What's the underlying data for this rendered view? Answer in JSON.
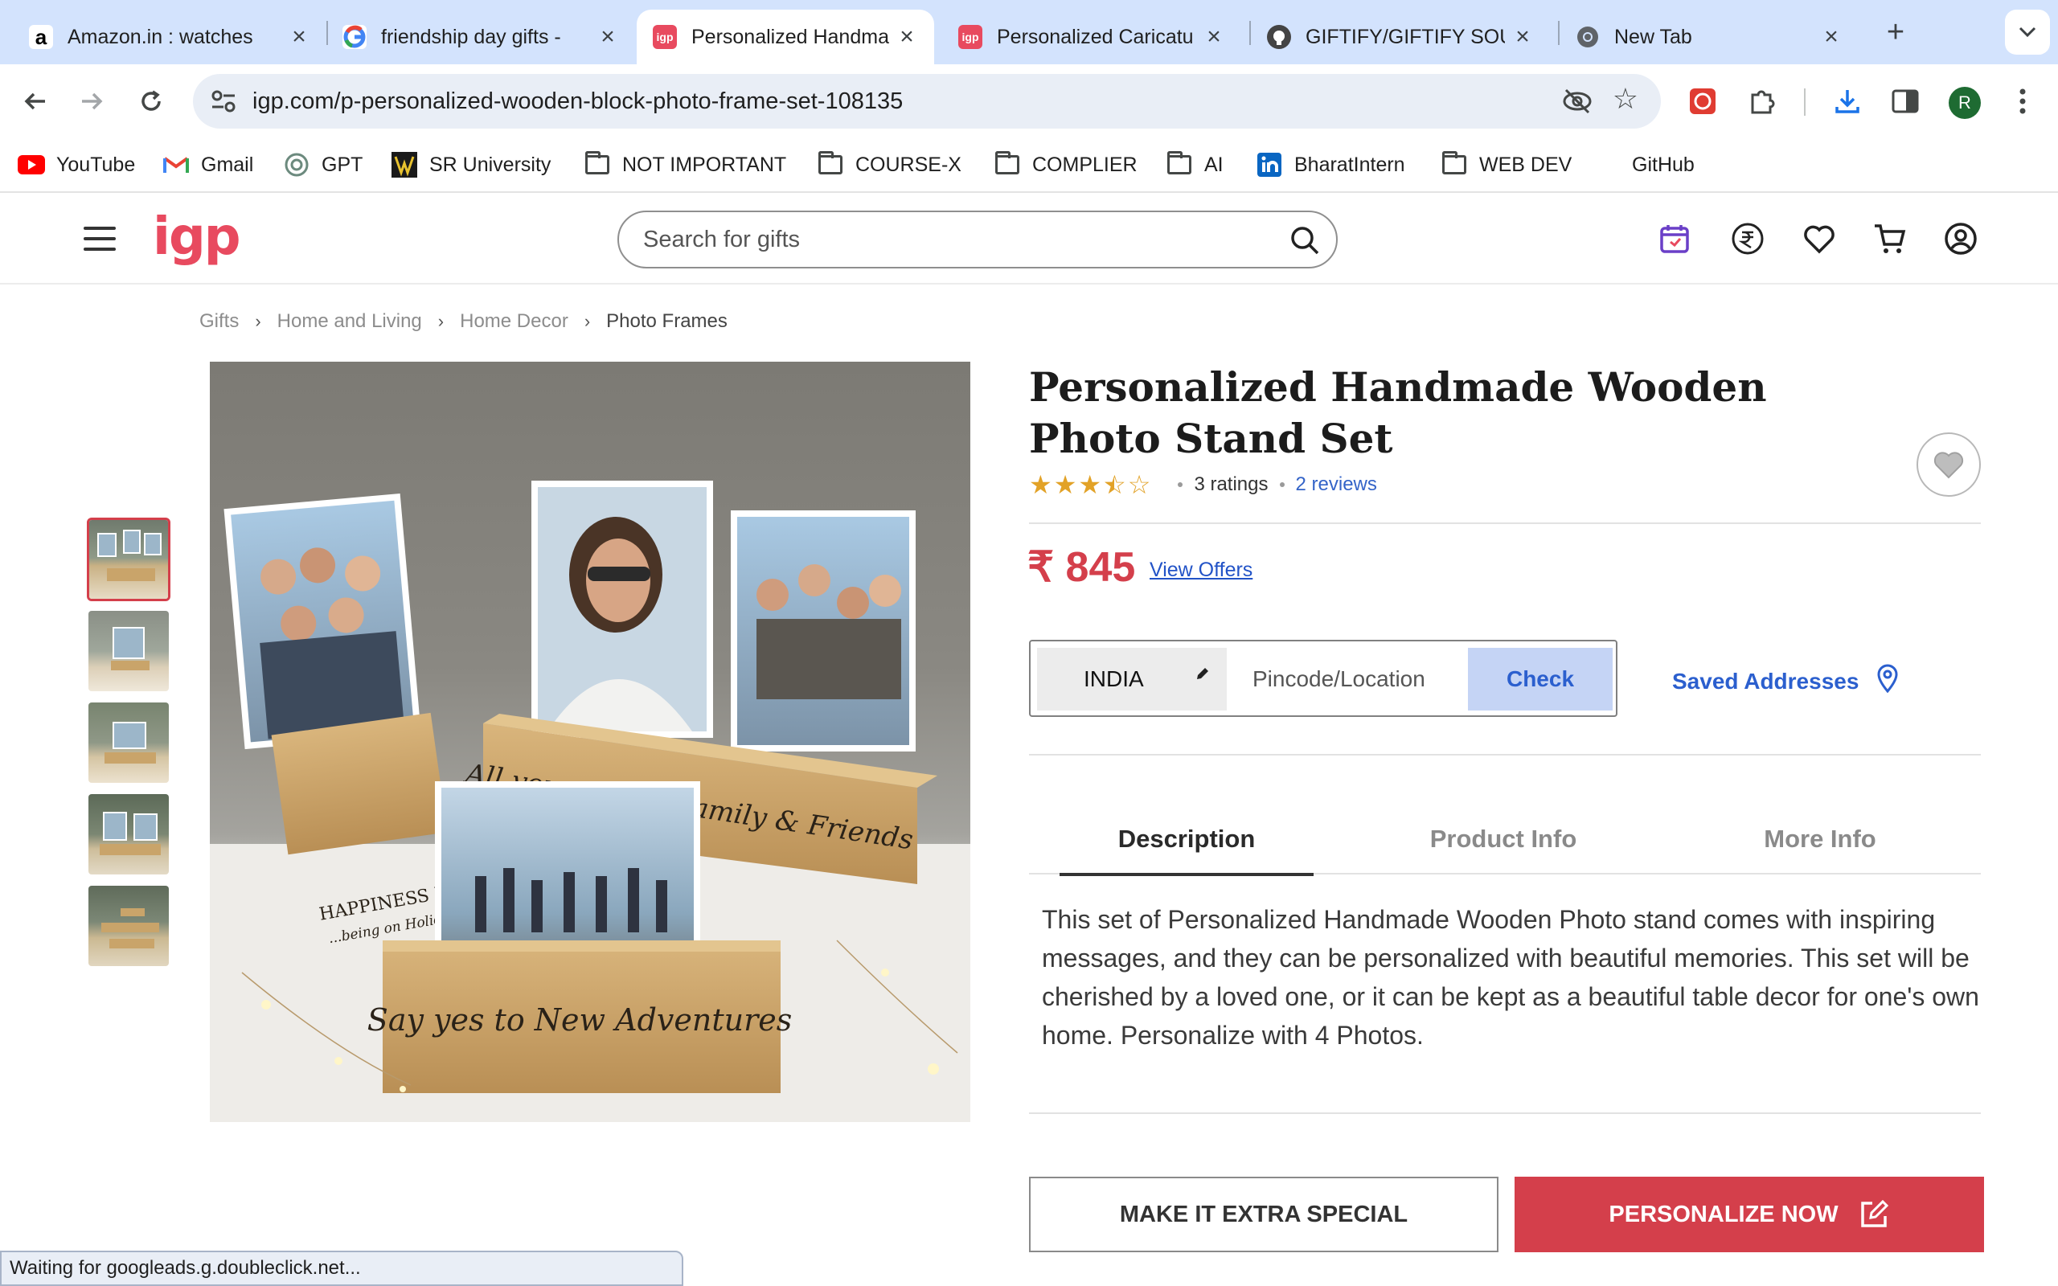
{
  "browser": {
    "tabs": [
      {
        "title": "Amazon.in : watches",
        "favicon": "amazon-icon"
      },
      {
        "title": "friendship day gifts -",
        "favicon": "google-icon"
      },
      {
        "title": "Personalized Handma",
        "favicon": "igp-icon",
        "active": true
      },
      {
        "title": "Personalized Caricatu",
        "favicon": "igp-icon"
      },
      {
        "title": "GIFTIFY/GIFTIFY SOU",
        "favicon": "github-icon"
      },
      {
        "title": "New Tab",
        "favicon": "chrome-icon"
      }
    ],
    "url": "igp.com/p-personalized-wooden-block-photo-frame-set-108135",
    "profile_initial": "R",
    "bookmarks": [
      {
        "label": "YouTube",
        "icon": "youtube-icon"
      },
      {
        "label": "Gmail",
        "icon": "gmail-icon"
      },
      {
        "label": "GPT",
        "icon": "openai-icon"
      },
      {
        "label": "SR University",
        "icon": "sr-university-icon"
      },
      {
        "label": "NOT IMPORTANT",
        "icon": "folder-icon"
      },
      {
        "label": "COURSE-X",
        "icon": "folder-icon"
      },
      {
        "label": "COMPLIER",
        "icon": "folder-icon"
      },
      {
        "label": "AI",
        "icon": "folder-icon"
      },
      {
        "label": "BharatIntern",
        "icon": "linkedin-icon"
      },
      {
        "label": "WEB DEV",
        "icon": "folder-icon"
      },
      {
        "label": "GitHub",
        "icon": "none"
      }
    ],
    "status_text": "Waiting for googleads.g.doubleclick.net..."
  },
  "site": {
    "logo": "igp",
    "search_placeholder": "Search for gifts",
    "header_icons": [
      "calendar-icon",
      "rupee-currency-icon",
      "wishlist-heart-icon",
      "cart-icon",
      "account-icon"
    ],
    "brand_color": "#e84a5f"
  },
  "breadcrumb": [
    "Gifts",
    "Home and Living",
    "Home Decor",
    "Photo Frames"
  ],
  "product": {
    "title": "Personalized Handmade Wooden Photo Stand Set",
    "rating_value": 3.5,
    "rating_max": 5,
    "ratings_text": "3 ratings",
    "reviews_text": "2 reviews",
    "currency_symbol": "₹",
    "price": "845",
    "view_offers": "View Offers",
    "image_count": 5,
    "image_texts": {
      "block_left": "HAPPINESS IS",
      "block_left_sub": "...being on Holiday",
      "block_right": "All you need is Family & Friends",
      "block_front": "Say yes to New Adventures"
    }
  },
  "delivery": {
    "country": "INDIA",
    "pincode_placeholder": "Pincode/Location",
    "check_label": "Check",
    "saved_addresses": "Saved Addresses"
  },
  "tabs": [
    {
      "label": "Description",
      "active": true
    },
    {
      "label": "Product Info",
      "active": false
    },
    {
      "label": "More Info",
      "active": false
    }
  ],
  "description": "This set of Personalized Handmade Wooden Photo stand comes with inspiring messages, and they can be personalized with beautiful memories. This set will be cherished by a loved one, or it can be kept as a beautiful table decor for one's own home. Personalize with 4 Photos.",
  "actions": {
    "secondary": "MAKE IT EXTRA SPECIAL",
    "primary": "PERSONALIZE NOW"
  },
  "colors": {
    "accent_red": "#d43f4b",
    "link_blue": "#2b5fce",
    "star_gold": "#e2a227"
  }
}
